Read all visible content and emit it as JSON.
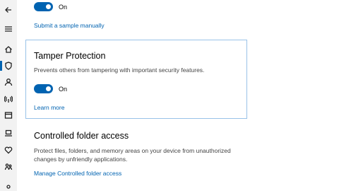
{
  "sidebar": {
    "icons": [
      "back-icon",
      "hamburger-icon",
      "home-icon",
      "shield-icon",
      "person-icon",
      "wireless-icon",
      "app-browser-icon",
      "laptop-icon",
      "heart-icon",
      "family-icon"
    ]
  },
  "top_toggle": {
    "state_label": "On"
  },
  "submit_sample_link": "Submit a sample manually",
  "tamper": {
    "title": "Tamper Protection",
    "description": "Prevents others from tampering with important security features.",
    "state_label": "On",
    "learn_more": "Learn more"
  },
  "cfa": {
    "title": "Controlled folder access",
    "description_line1": "Protect files, folders, and memory areas on your device from unauthorized",
    "description_line2": "changes by unfriendly applications.",
    "manage_link": "Manage Controlled folder access"
  },
  "colors": {
    "accent": "#0063b1",
    "focus_border": "#99c2e8",
    "sidebar_bg": "#f2f2f2"
  }
}
